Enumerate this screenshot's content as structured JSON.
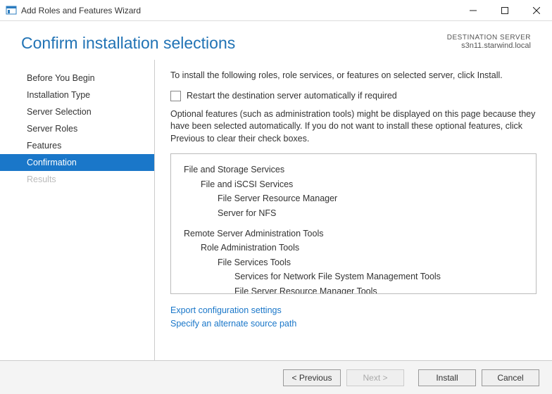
{
  "window": {
    "title": "Add Roles and Features Wizard"
  },
  "header": {
    "page_title": "Confirm installation selections",
    "destination_label": "DESTINATION SERVER",
    "destination_value": "s3n11.starwind.local"
  },
  "sidebar": {
    "items": [
      {
        "label": "Before You Begin",
        "state": "normal"
      },
      {
        "label": "Installation Type",
        "state": "normal"
      },
      {
        "label": "Server Selection",
        "state": "normal"
      },
      {
        "label": "Server Roles",
        "state": "normal"
      },
      {
        "label": "Features",
        "state": "normal"
      },
      {
        "label": "Confirmation",
        "state": "active"
      },
      {
        "label": "Results",
        "state": "disabled"
      }
    ]
  },
  "content": {
    "intro": "To install the following roles, role services, or features on selected server, click Install.",
    "restart_label": "Restart the destination server automatically if required",
    "restart_checked": false,
    "note": "Optional features (such as administration tools) might be displayed on this page because they have been selected automatically. If you do not want to install these optional features, click Previous to clear their check boxes.",
    "tree": [
      {
        "level": 0,
        "label": "File and Storage Services"
      },
      {
        "level": 1,
        "label": "File and iSCSI Services"
      },
      {
        "level": 2,
        "label": "File Server Resource Manager"
      },
      {
        "level": 2,
        "label": "Server for NFS"
      },
      {
        "level": 0,
        "label": "Remote Server Administration Tools"
      },
      {
        "level": 1,
        "label": "Role Administration Tools"
      },
      {
        "level": 2,
        "label": "File Services Tools"
      },
      {
        "level": 3,
        "label": "Services for Network File System Management Tools"
      },
      {
        "level": 3,
        "label": "File Server Resource Manager Tools"
      }
    ],
    "links": {
      "export": "Export configuration settings",
      "alt_source": "Specify an alternate source path"
    }
  },
  "footer": {
    "previous": "< Previous",
    "next": "Next >",
    "install": "Install",
    "cancel": "Cancel"
  }
}
